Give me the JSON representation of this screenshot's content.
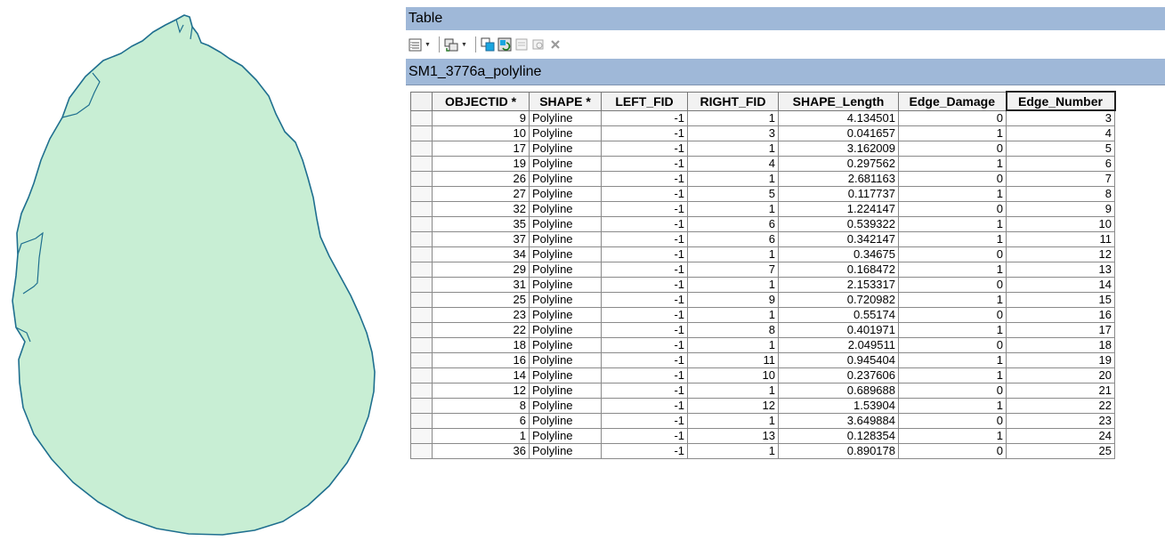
{
  "window": {
    "title": "Table"
  },
  "layer": {
    "tab_label": "SM1_3776a_polyline"
  },
  "toolbar": {
    "icons": [
      "table-options-icon",
      "related-tables-icon",
      "select-by-attributes-icon",
      "switch-selection-icon",
      "clear-selection-icon",
      "zoom-to-selected-icon",
      "delete-selected-icon"
    ]
  },
  "colors": {
    "shape_fill": "#c8eed4",
    "shape_stroke": "#1f6f8f",
    "title_bar": "#9fb8d8"
  },
  "table": {
    "columns": [
      "OBJECTID *",
      "SHAPE *",
      "LEFT_FID",
      "RIGHT_FID",
      "SHAPE_Length",
      "Edge_Damage",
      "Edge_Number"
    ],
    "rows": [
      [
        "9",
        "Polyline",
        "-1",
        "1",
        "4.134501",
        "0",
        "3"
      ],
      [
        "10",
        "Polyline",
        "-1",
        "3",
        "0.041657",
        "1",
        "4"
      ],
      [
        "17",
        "Polyline",
        "-1",
        "1",
        "3.162009",
        "0",
        "5"
      ],
      [
        "19",
        "Polyline",
        "-1",
        "4",
        "0.297562",
        "1",
        "6"
      ],
      [
        "26",
        "Polyline",
        "-1",
        "1",
        "2.681163",
        "0",
        "7"
      ],
      [
        "27",
        "Polyline",
        "-1",
        "5",
        "0.117737",
        "1",
        "8"
      ],
      [
        "32",
        "Polyline",
        "-1",
        "1",
        "1.224147",
        "0",
        "9"
      ],
      [
        "35",
        "Polyline",
        "-1",
        "6",
        "0.539322",
        "1",
        "10"
      ],
      [
        "37",
        "Polyline",
        "-1",
        "6",
        "0.342147",
        "1",
        "11"
      ],
      [
        "34",
        "Polyline",
        "-1",
        "1",
        "0.34675",
        "0",
        "12"
      ],
      [
        "29",
        "Polyline",
        "-1",
        "7",
        "0.168472",
        "1",
        "13"
      ],
      [
        "31",
        "Polyline",
        "-1",
        "1",
        "2.153317",
        "0",
        "14"
      ],
      [
        "25",
        "Polyline",
        "-1",
        "9",
        "0.720982",
        "1",
        "15"
      ],
      [
        "23",
        "Polyline",
        "-1",
        "1",
        "0.55174",
        "0",
        "16"
      ],
      [
        "22",
        "Polyline",
        "-1",
        "8",
        "0.401971",
        "1",
        "17"
      ],
      [
        "18",
        "Polyline",
        "-1",
        "1",
        "2.049511",
        "0",
        "18"
      ],
      [
        "16",
        "Polyline",
        "-1",
        "11",
        "0.945404",
        "1",
        "19"
      ],
      [
        "14",
        "Polyline",
        "-1",
        "10",
        "0.237606",
        "1",
        "20"
      ],
      [
        "12",
        "Polyline",
        "-1",
        "1",
        "0.689688",
        "0",
        "21"
      ],
      [
        "8",
        "Polyline",
        "-1",
        "12",
        "1.53904",
        "1",
        "22"
      ],
      [
        "6",
        "Polyline",
        "-1",
        "1",
        "3.649884",
        "0",
        "23"
      ],
      [
        "1",
        "Polyline",
        "-1",
        "13",
        "0.128354",
        "1",
        "24"
      ],
      [
        "36",
        "Polyline",
        "-1",
        "1",
        "0.890178",
        "0",
        "25"
      ]
    ]
  }
}
